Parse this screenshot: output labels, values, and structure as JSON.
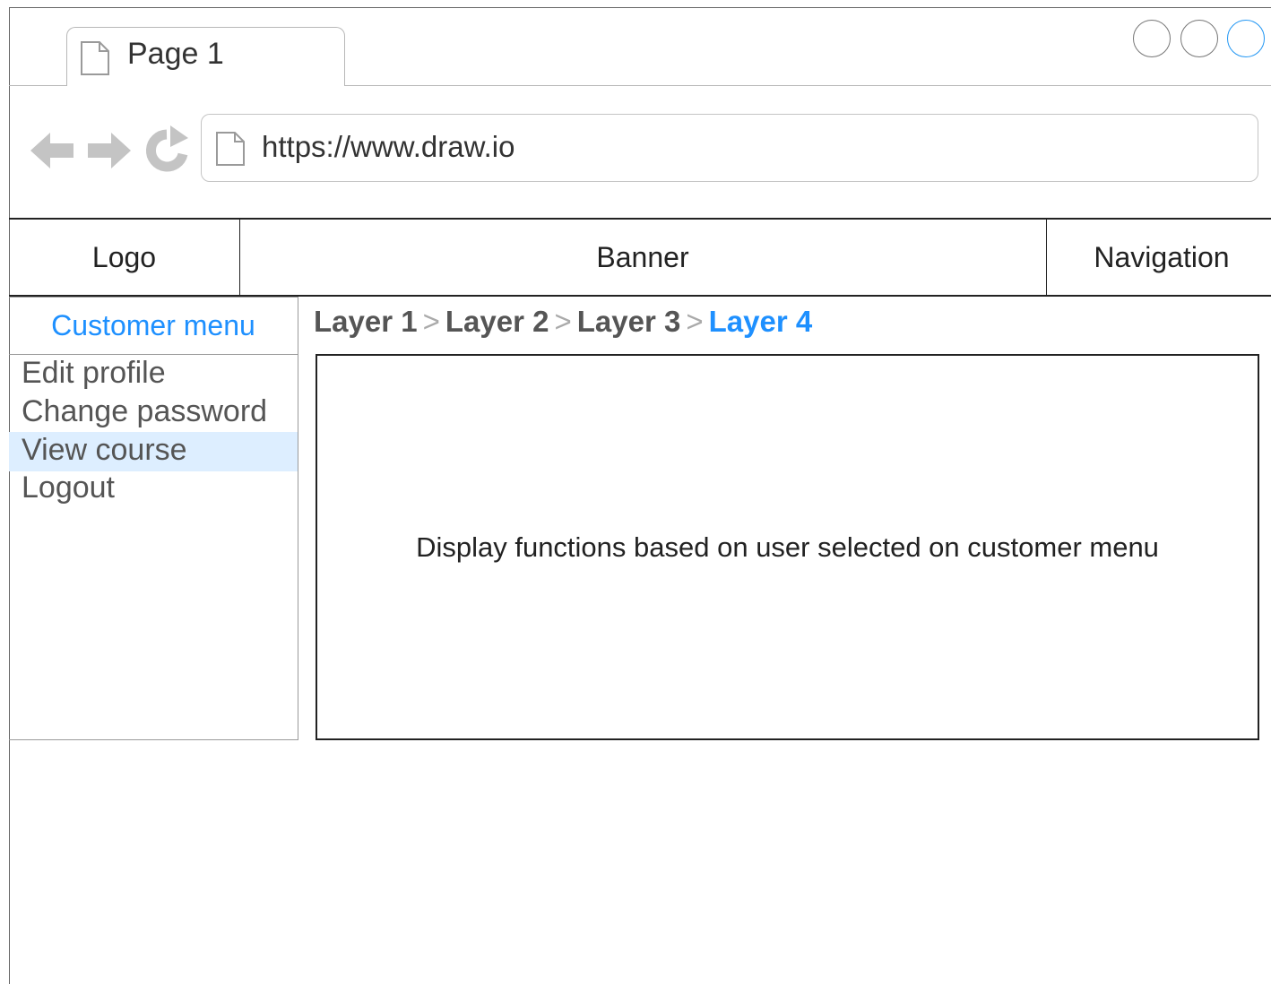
{
  "browser": {
    "tab_title": "Page 1",
    "url": "https://www.draw.io",
    "window_buttons": [
      "minimize",
      "maximize",
      "close"
    ]
  },
  "header": {
    "logo": "Logo",
    "banner": "Banner",
    "navigation": "Navigation"
  },
  "sidebar": {
    "title": "Customer menu",
    "items": [
      {
        "label": "Edit profile",
        "selected": false
      },
      {
        "label": "Change password",
        "selected": false
      },
      {
        "label": "View course",
        "selected": true
      },
      {
        "label": "Logout",
        "selected": false
      }
    ]
  },
  "breadcrumb": {
    "items": [
      "Layer 1",
      "Layer 2",
      "Layer 3",
      "Layer 4"
    ],
    "separator": ">"
  },
  "main": {
    "content_text": "Display functions based on user selected on customer menu"
  },
  "colors": {
    "accent": "#1e90ff",
    "selected_bg": "#ddeeff"
  }
}
